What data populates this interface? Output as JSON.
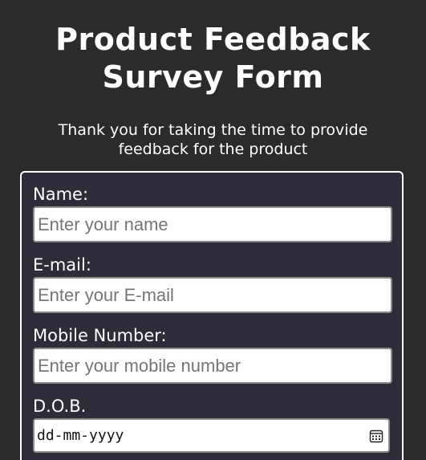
{
  "header": {
    "title_line1": "Product Feedback",
    "title_line2": "Survey Form",
    "description": "Thank you for taking the time to provide feedback for the product"
  },
  "form": {
    "name": {
      "label": "Name:",
      "placeholder": "Enter your name"
    },
    "email": {
      "label": "E-mail:",
      "placeholder": "Enter your E-mail"
    },
    "mobile": {
      "label": "Mobile Number:",
      "placeholder": "Enter your mobile number"
    },
    "dob": {
      "label": "D.O.B.",
      "placeholder": "dd-mm-yyyy",
      "icon": "calendar-icon"
    }
  },
  "colors": {
    "page_background": "#2b2b2b",
    "card_background": "#2d2d3a",
    "text": "#ffffff",
    "placeholder": "#757575"
  }
}
